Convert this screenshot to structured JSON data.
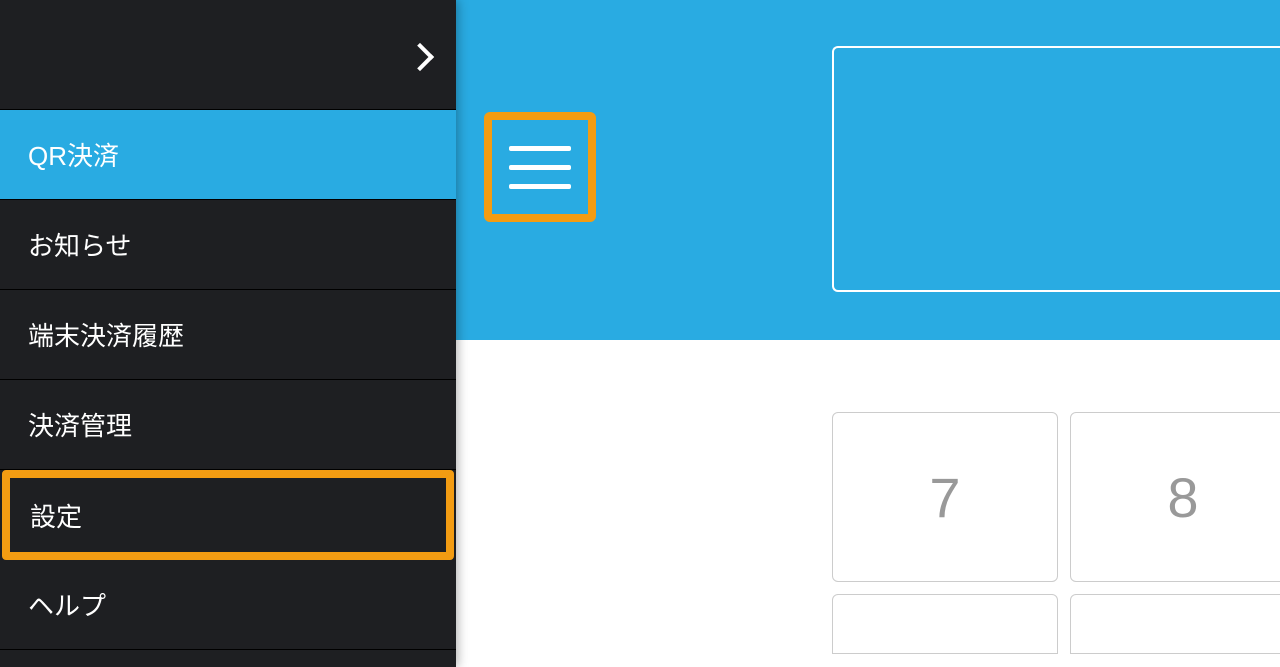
{
  "sidebar": {
    "items": [
      {
        "label": "QR決済",
        "active": true
      },
      {
        "label": "お知らせ",
        "active": false
      },
      {
        "label": "端末決済履歴",
        "active": false
      },
      {
        "label": "決済管理",
        "active": false
      },
      {
        "label": "設定",
        "active": false,
        "highlighted": true
      },
      {
        "label": "ヘルプ",
        "active": false
      }
    ]
  },
  "keypad": {
    "keys": [
      "7",
      "8"
    ]
  },
  "colors": {
    "accent": "#29abe2",
    "highlight": "#f39c12",
    "sidebar_bg": "#1e1f22"
  }
}
